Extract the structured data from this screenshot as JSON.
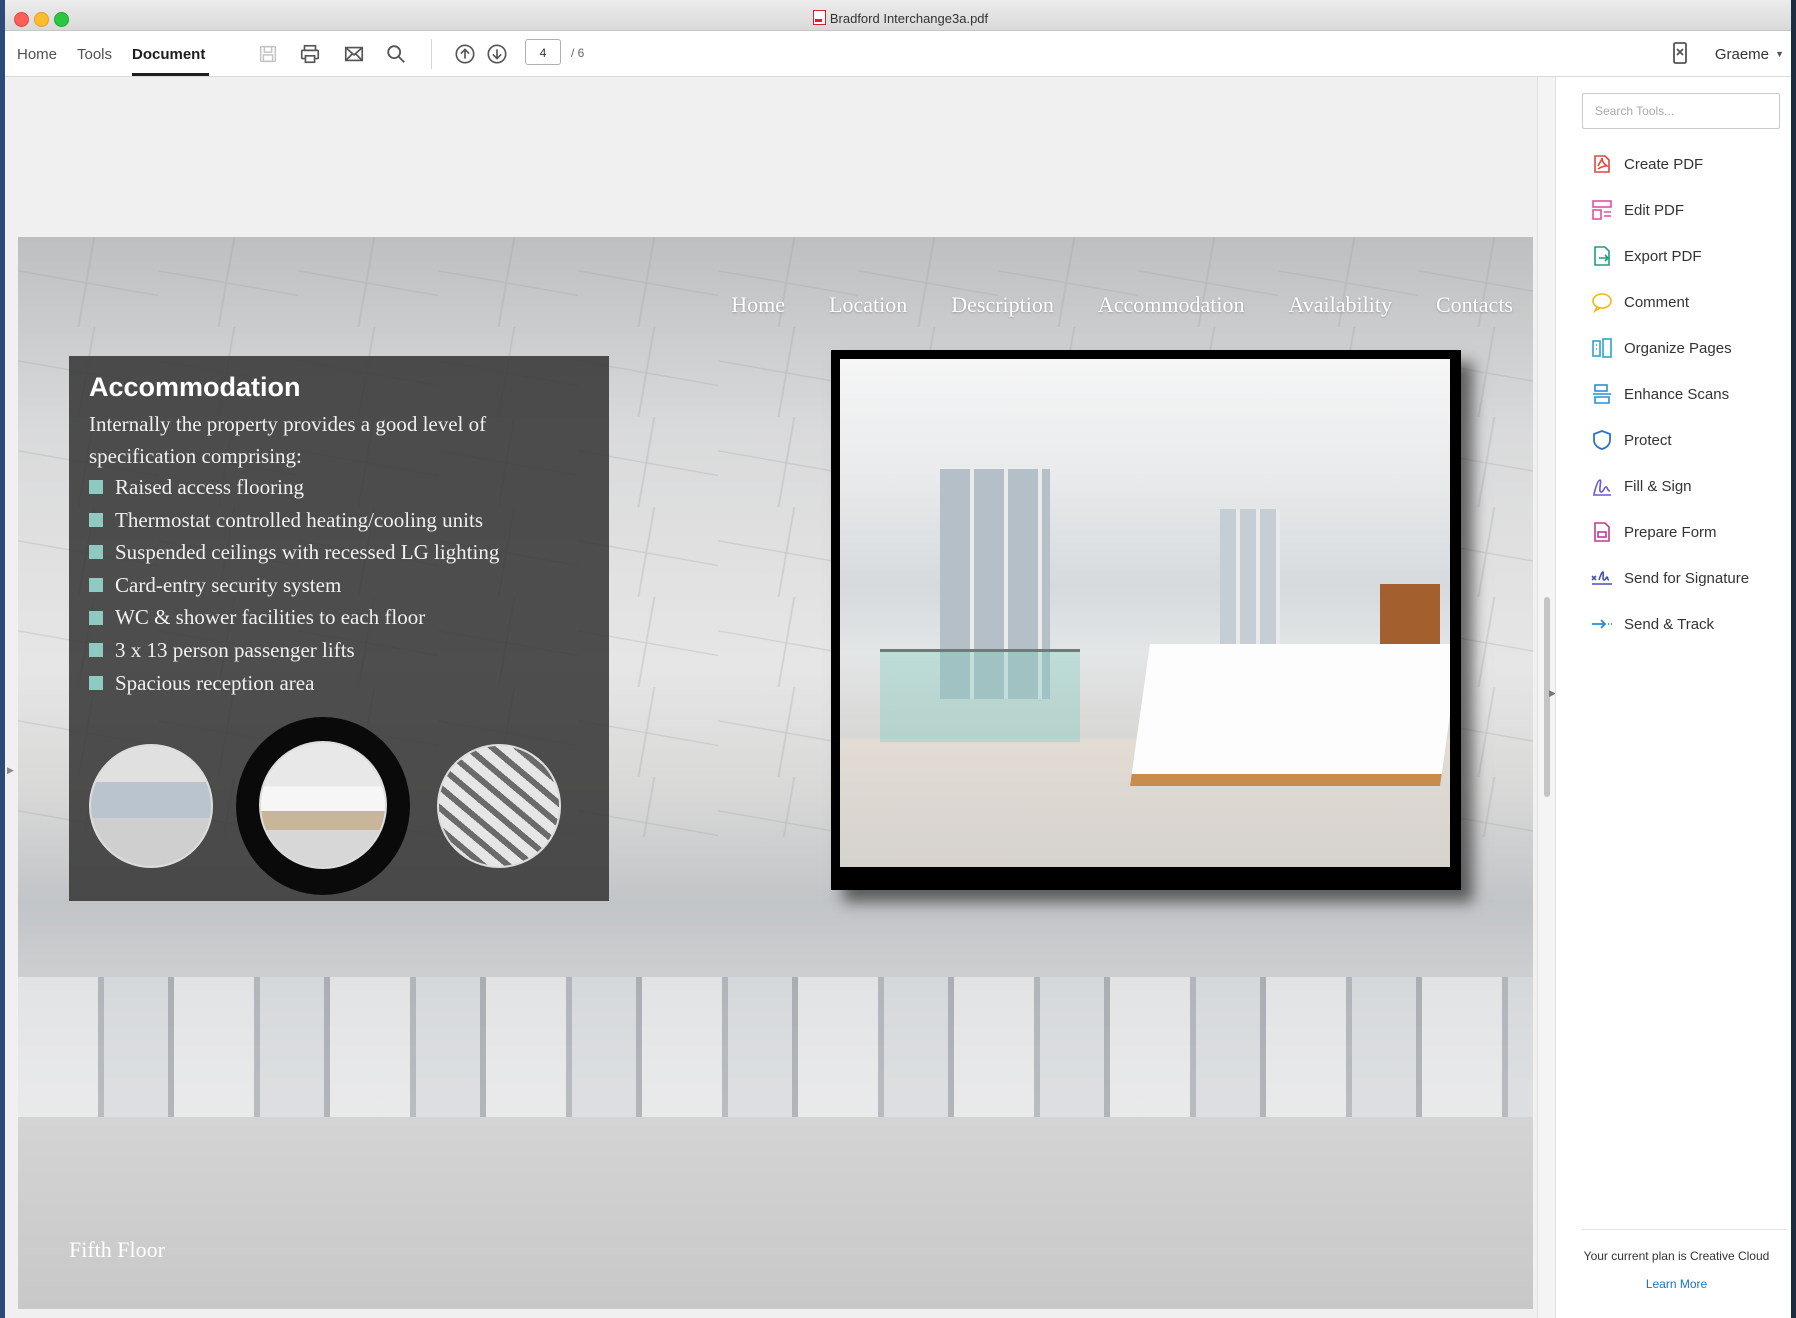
{
  "window": {
    "title": "Bradford Interchange3a.pdf"
  },
  "toolbar": {
    "tabs": [
      "Home",
      "Tools",
      "Document"
    ],
    "active_tab": "Document",
    "page_current": "4",
    "page_total": "/ 6",
    "user": "Graeme",
    "icons": [
      "save-icon",
      "print-icon",
      "mail-icon",
      "search-icon",
      "page-up-icon",
      "page-down-icon",
      "phone-icon"
    ]
  },
  "document": {
    "nav": [
      "Home",
      "Location",
      "Description",
      "Accommodation",
      "Availability",
      "Contacts"
    ],
    "panel": {
      "heading": "Accommodation",
      "intro": "Internally the property provides a good level of specification comprising:",
      "bullets": [
        "Raised access flooring",
        "Thermostat controlled heating/cooling units",
        "Suspended ceilings with recessed LG lighting",
        "Card-entry security system",
        "WC & shower facilities to each floor",
        "3 x 13 person passenger lifts",
        "Spacious reception area"
      ],
      "bullet_color": "#8ecac0"
    },
    "caption": "Fifth Floor"
  },
  "sidebar": {
    "search_placeholder": "Search Tools...",
    "tools": [
      {
        "label": "Create PDF",
        "icon": "create-pdf-icon",
        "color": "#e2463a"
      },
      {
        "label": "Edit PDF",
        "icon": "edit-pdf-icon",
        "color": "#e052a4"
      },
      {
        "label": "Export PDF",
        "icon": "export-pdf-icon",
        "color": "#1e9e82"
      },
      {
        "label": "Comment",
        "icon": "comment-icon",
        "color": "#f2b90c"
      },
      {
        "label": "Organize Pages",
        "icon": "organize-pages-icon",
        "color": "#2aa6c9"
      },
      {
        "label": "Enhance Scans",
        "icon": "enhance-scans-icon",
        "color": "#2c8fd1"
      },
      {
        "label": "Protect",
        "icon": "protect-icon",
        "color": "#2f71c8"
      },
      {
        "label": "Fill & Sign",
        "icon": "fill-sign-icon",
        "color": "#6b58c9"
      },
      {
        "label": "Prepare Form",
        "icon": "prepare-form-icon",
        "color": "#c13b8f"
      },
      {
        "label": "Send for Signature",
        "icon": "send-signature-icon",
        "color": "#4450b5"
      },
      {
        "label": "Send & Track",
        "icon": "send-track-icon",
        "color": "#2a8bd0"
      }
    ],
    "plan_text": "Your current plan is Creative Cloud",
    "learn_more": "Learn More"
  }
}
